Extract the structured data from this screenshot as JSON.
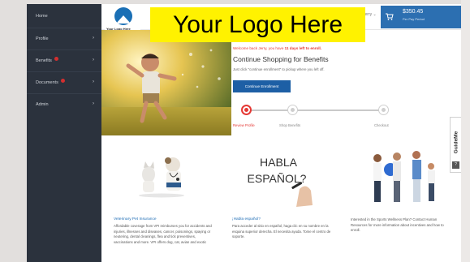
{
  "sidebar": {
    "items": [
      {
        "label": "Home",
        "has_chevron": false,
        "badge": false
      },
      {
        "label": "Profile",
        "has_chevron": true,
        "badge": false
      },
      {
        "label": "Benefits",
        "has_chevron": true,
        "badge": true
      },
      {
        "label": "Documents",
        "has_chevron": true,
        "badge": true
      },
      {
        "label": "Admin",
        "has_chevron": true,
        "badge": false
      }
    ]
  },
  "header": {
    "logo_caption": "Your Logo Here",
    "logo_banner": "Your Logo Here",
    "user_menu": "Jerry",
    "cart_total": "$350.45",
    "cart_sub": "Per Pay Period",
    "cart_icon": "shopping-cart-icon"
  },
  "hero": {
    "welcome_prefix": "Welcome back Jerry, you have ",
    "welcome_days": "11 days left to enroll.",
    "headline": "Continue Shopping for Benefits",
    "subtext": "Just click \"continue enrollment\" to pickup where you left off.",
    "button": "Continue Enrollment"
  },
  "progress": {
    "steps": [
      "Review Profile",
      "Shop Benefits",
      "Checkout"
    ],
    "active_index": 0
  },
  "cards": [
    {
      "title": "Veterinary Pet Insurance",
      "body": "Affordable coverage from VPI reimburses you for accidents and injuries, illnesses and diseases, cancer, poisonings, spaying or neutering, dental cleanings, flea and tick preventives, vaccinations and more. VPI offers dog, cat, avian and exotic"
    },
    {
      "title": "¡Habla español?",
      "image_text_line1": "HABLA",
      "image_text_line2": "ESPAÑOL?",
      "body": "Para acceder al sitio en español, haga clic en su nombre en la esquina superior derecha. El necesita ayuda. Tome el centro de soporte."
    },
    {
      "title": "",
      "body": "Interested in the Sports Wellness Plan? Contact Human Resources for more information about incentives and how to enroll."
    }
  ],
  "guide": {
    "label": "GuideMe",
    "icon": "?"
  },
  "colors": {
    "sidebar": "#2b323d",
    "accent_blue": "#1d5fa5",
    "alert_red": "#e53935",
    "banner_yellow": "#fff200"
  }
}
